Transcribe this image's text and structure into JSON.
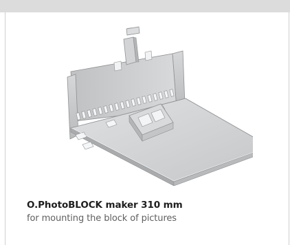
{
  "product": {
    "title": "O.PhotoBLOCK maker 310 mm",
    "subtitle": "for mounting the block of pictures",
    "image_subject": "metal-plate-bracket"
  },
  "colors": {
    "top_band": "#dcdcdc",
    "card_border": "#cfcfcf",
    "title_text": "#1e1e1e",
    "subtitle_text": "#5f5f5f"
  }
}
